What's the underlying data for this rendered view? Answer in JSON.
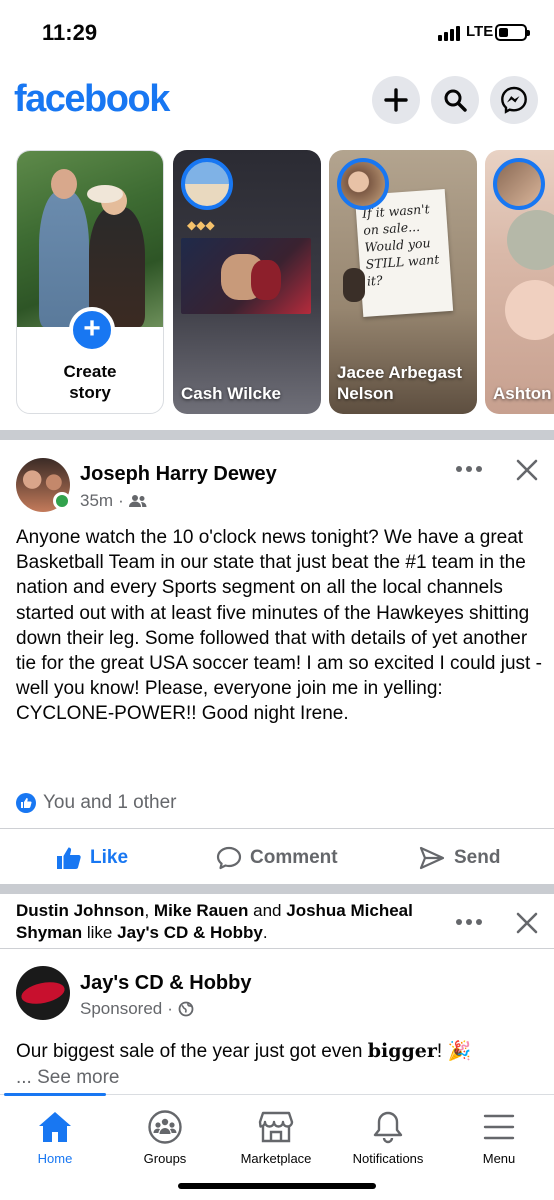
{
  "status_bar": {
    "time": "11:29",
    "network": "LTE"
  },
  "header": {
    "logo": "facebook",
    "icons": [
      "plus-icon",
      "search-icon",
      "messenger-icon"
    ],
    "brand_color": "#1877f2"
  },
  "stories": {
    "create": {
      "label": "Create\nstory"
    },
    "items": [
      {
        "name": "Cash Wilcke"
      },
      {
        "name": "Jacee Arbegast Nelson",
        "note": "If it wasn't on sale... Would you STILL want it?"
      },
      {
        "name": "Ashton"
      }
    ]
  },
  "post": {
    "author": "Joseph Harry Dewey",
    "time": "35m",
    "audience_icon": "friends-icon",
    "text": "Anyone watch the 10 o'clock news tonight? We have a great Basketball Team in our state that just beat the #1 team in the nation and every Sports segment on all the local channels started out with at least five minutes of the Hawkeyes shitting down their leg. Some followed that with details of yet another tie for the great USA soccer team! I am so excited I could just - well you know! Please, everyone join me in yelling: CYCLONE-POWER!! Good night Irene.",
    "reactions": "You and 1 other",
    "actions": {
      "like": "Like",
      "comment": "Comment",
      "send": "Send"
    }
  },
  "sponsored_post": {
    "context_names": [
      "Dustin Johnson",
      "Mike Rauen",
      "Joshua Micheal Shyman",
      "Jay's CD & Hobby"
    ],
    "context_and": "and",
    "context_like": "like",
    "page_name": "Jay's CD & Hobby",
    "sponsored": "Sponsored",
    "text_start": "Our biggest sale of the year just got even ",
    "text_bold": "bigger",
    "text_end": "! 🎉",
    "see_more": "... See more"
  },
  "tabbar": {
    "active": "Home",
    "tabs": [
      {
        "label": "Home",
        "icon": "home-icon"
      },
      {
        "label": "Groups",
        "icon": "groups-icon"
      },
      {
        "label": "Marketplace",
        "icon": "marketplace-icon"
      },
      {
        "label": "Notifications",
        "icon": "bell-icon"
      },
      {
        "label": "Menu",
        "icon": "menu-icon"
      }
    ]
  }
}
